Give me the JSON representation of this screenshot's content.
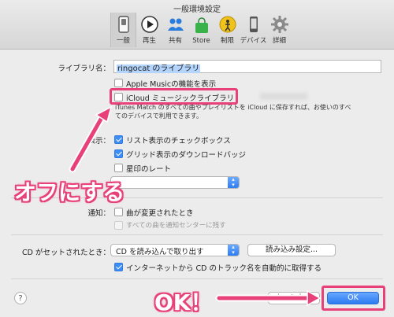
{
  "window": {
    "title": "一般環境設定"
  },
  "toolbar": [
    {
      "label": "一般",
      "icon": "general-switch-icon"
    },
    {
      "label": "再生",
      "icon": "play-icon"
    },
    {
      "label": "共有",
      "icon": "sharing-people-icon"
    },
    {
      "label": "Store",
      "icon": "store-bag-icon"
    },
    {
      "label": "制限",
      "icon": "restrictions-icon"
    },
    {
      "label": "デバイス",
      "icon": "device-phone-icon"
    },
    {
      "label": "詳細",
      "icon": "gear-icon"
    }
  ],
  "library": {
    "label": "ライブラリ名：",
    "value": "ringocat のライブラリ",
    "apple_music": "Apple Musicの機能を表示",
    "icloud": "iCloud ミュージックライブラリ",
    "desc_line1": "iTunes Match のすべての曲やプレイリストを iCloud に保存すれば、お使いのすべ",
    "desc_line2": "てのデバイスで利用できます。"
  },
  "view": {
    "label": "表示：",
    "list_checkbox": "リスト表示のチェックボックス",
    "grid_badge": "グリッド表示のダウンロードバッジ",
    "star_rating": "星印のレート"
  },
  "notify": {
    "label": "通知：",
    "song_change": "曲が変更されたとき",
    "notify_center": "すべての曲を通知センターに残す"
  },
  "cd": {
    "label": "CD がセットされたとき：",
    "select_value": "CD を読み込んで取り出す",
    "import_settings": "読み込み設定...",
    "lookup": "インターネットから CD のトラック名を自動的に取得する"
  },
  "footer": {
    "help": "?",
    "cancel": "キャンセル",
    "ok": "OK"
  },
  "annotations": {
    "turn_off": "オフにする",
    "ok": "OK！",
    "accent": "#e8417a"
  }
}
